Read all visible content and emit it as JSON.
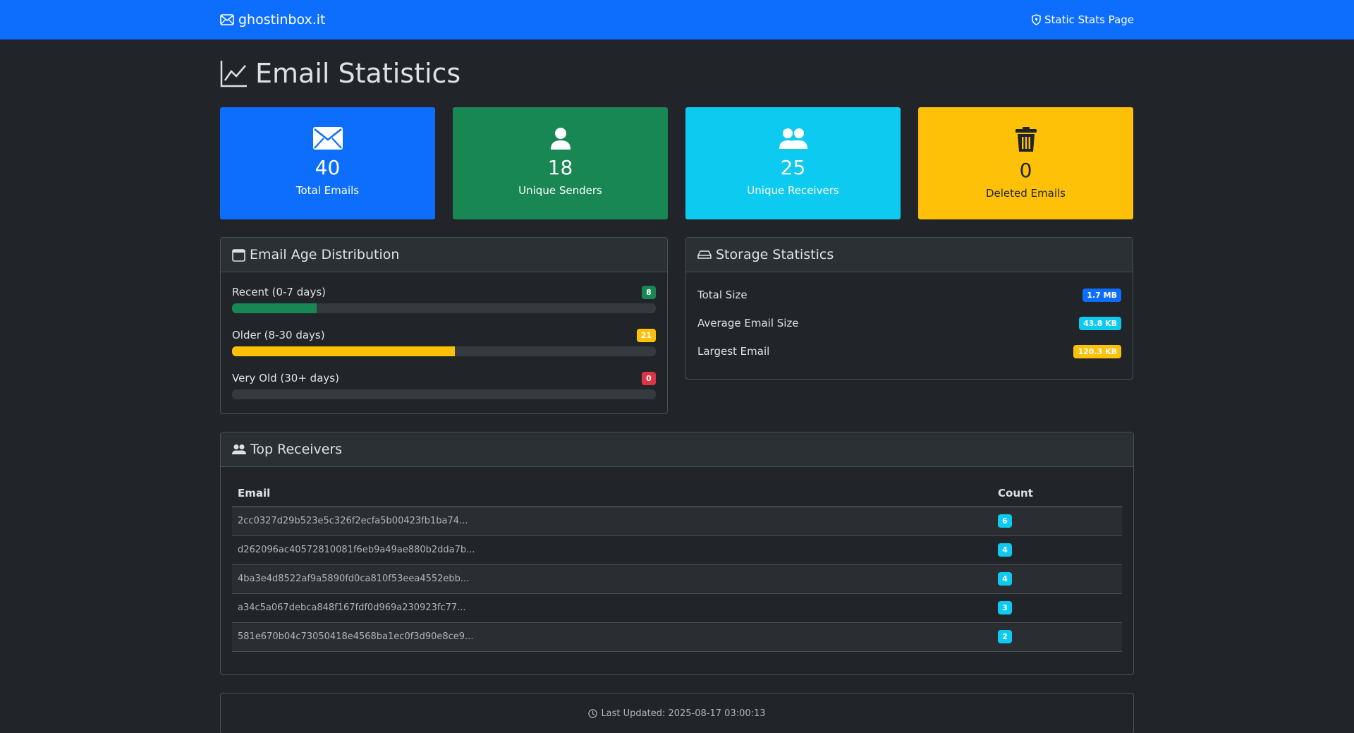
{
  "navbar": {
    "brand": "ghostinbox.it",
    "link": "Static Stats Page"
  },
  "page": {
    "title": "Email Statistics"
  },
  "cards": [
    {
      "icon": "envelope-icon",
      "value": "40",
      "label": "Total Emails",
      "color": "#0d6efd"
    },
    {
      "icon": "person-icon",
      "value": "18",
      "label": "Unique Senders",
      "color": "#198754"
    },
    {
      "icon": "people-icon",
      "value": "25",
      "label": "Unique Receivers",
      "color": "#0dcaf0"
    },
    {
      "icon": "trash-icon",
      "value": "0",
      "label": "Deleted Emails",
      "color": "#ffc107"
    }
  ],
  "age": {
    "title": "Email Age Distribution",
    "rows": [
      {
        "label": "Recent (0-7 days)",
        "count": "8",
        "percent": 20,
        "color": "#198754"
      },
      {
        "label": "Older (8-30 days)",
        "count": "21",
        "percent": 52.5,
        "color": "#ffc107"
      },
      {
        "label": "Very Old (30+ days)",
        "count": "0",
        "percent": 0,
        "color": "#dc3545"
      }
    ]
  },
  "storage": {
    "title": "Storage Statistics",
    "rows": [
      {
        "label": "Total Size",
        "value": "1.7 MB"
      },
      {
        "label": "Average Email Size",
        "value": "43.8 KB"
      },
      {
        "label": "Largest Email",
        "value": "120.3 KB"
      }
    ]
  },
  "receivers": {
    "title": "Top Receivers",
    "col_email": "Email",
    "col_count": "Count",
    "rows": [
      {
        "email": "2cc0327d29b523e5c326f2ecfa5b00423fb1ba74...",
        "count": "6"
      },
      {
        "email": "d262096ac40572810081f6eb9a49ae880b2dda7b...",
        "count": "4"
      },
      {
        "email": "4ba3e4d8522af9a5890fd0ca810f53eea4552ebb...",
        "count": "4"
      },
      {
        "email": "a34c5a067debca848f167fdf0d969a230923fc77...",
        "count": "3"
      },
      {
        "email": "581e670b04c73050418e4568ba1ec0f3d90e8ce9...",
        "count": "2"
      }
    ]
  },
  "footer": {
    "text": "Last Updated: 2025-08-17 03:00:13"
  }
}
